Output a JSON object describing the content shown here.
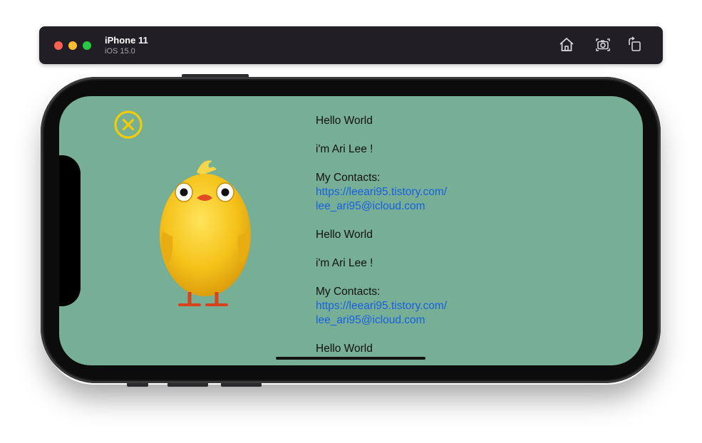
{
  "simulator": {
    "device_name": "iPhone 11",
    "os_version": "iOS 15.0",
    "toolbar_icons": [
      "home-icon",
      "screenshot-icon",
      "rotate-icon"
    ]
  },
  "app": {
    "close_icon": "close-icon",
    "illustration": "chick-illustration",
    "colors": {
      "background": "#76af95",
      "close_accent": "#f2cc07",
      "link": "#1a5fe0"
    },
    "blocks": [
      {
        "greeting": "Hello World",
        "intro": "i'm Ari Lee !",
        "contacts_label": "My Contacts:",
        "blog_link": "https://leeari95.tistory.com/",
        "email_link": "lee_ari95@icloud.com"
      },
      {
        "greeting": "Hello World",
        "intro": "i'm Ari Lee !",
        "contacts_label": "My Contacts:",
        "blog_link": "https://leeari95.tistory.com/",
        "email_link": "lee_ari95@icloud.com"
      },
      {
        "greeting": "Hello World"
      }
    ]
  }
}
